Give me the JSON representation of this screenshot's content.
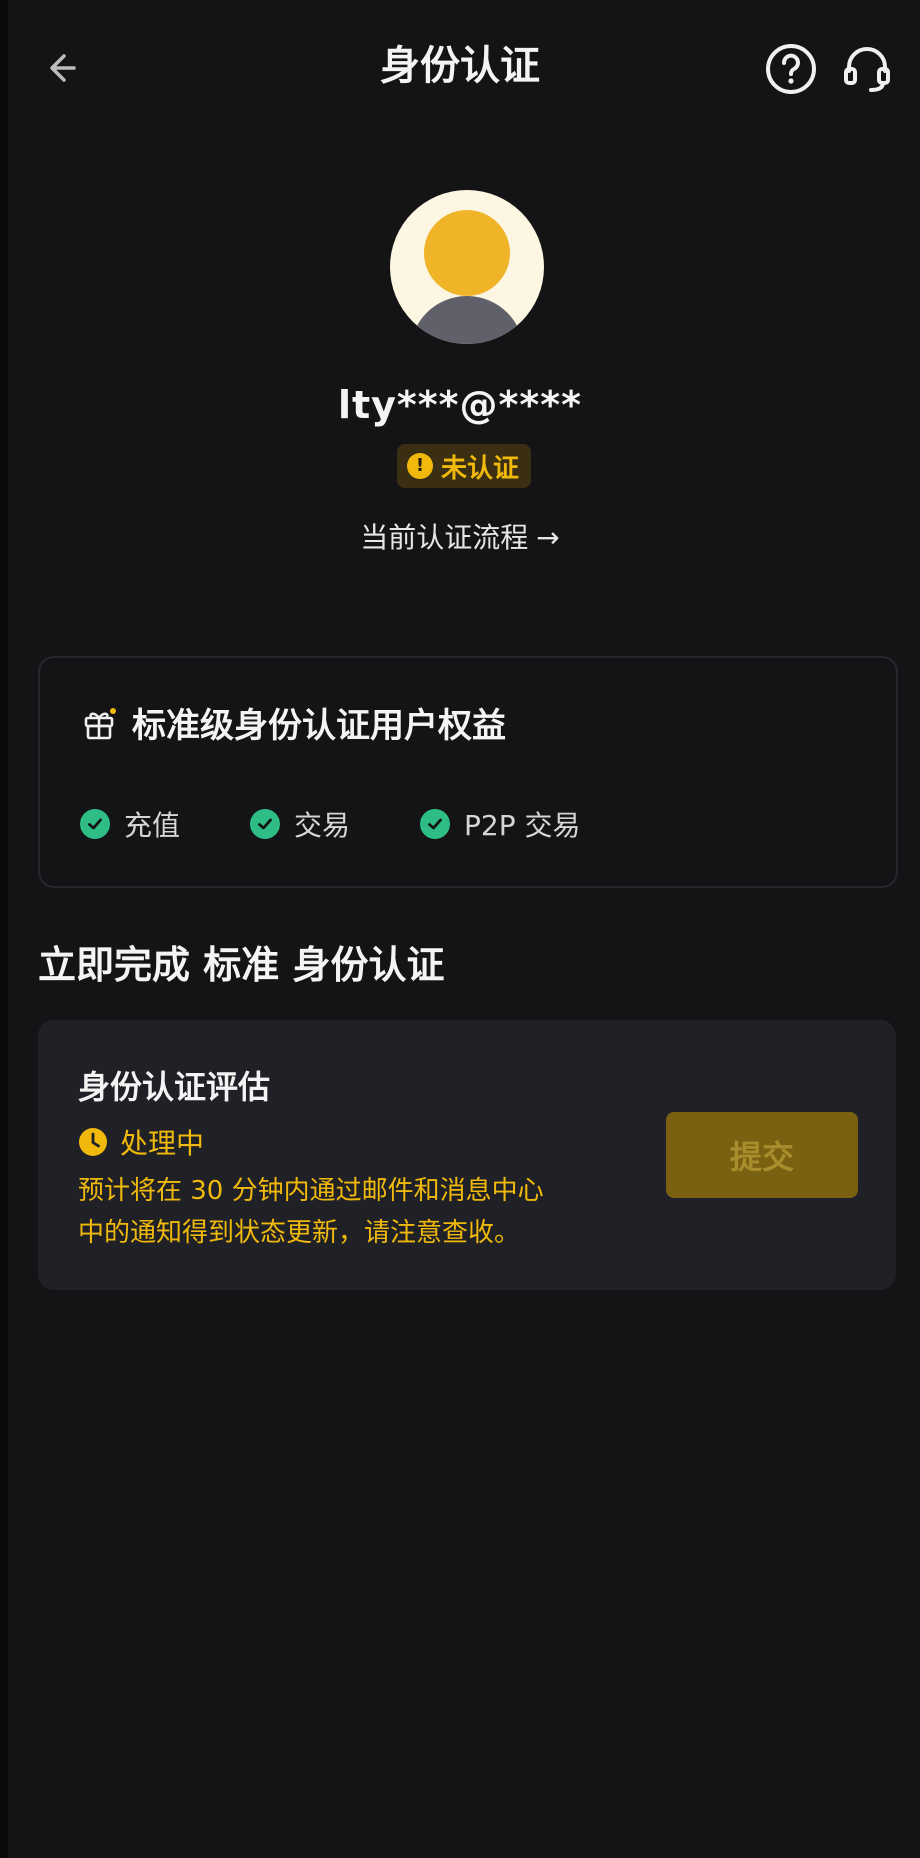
{
  "header": {
    "title": "身份认证"
  },
  "profile": {
    "username": "lty***@****",
    "status_label": "未认证",
    "process_link": "当前认证流程",
    "process_arrow": "→"
  },
  "benefits": {
    "title": "标准级身份认证用户权益",
    "items": [
      {
        "label": "充值"
      },
      {
        "label": "交易"
      },
      {
        "label": "P2P 交易"
      }
    ]
  },
  "section": {
    "heading": "立即完成 标准 身份认证"
  },
  "assessment": {
    "title": "身份认证评估",
    "status": "处理中",
    "description_line1": "预计将在 30 分钟内通过邮件和消息中心",
    "description_line2": "中的通知得到状态更新，请注意查收。",
    "submit_label": "提交"
  },
  "colors": {
    "accent": "#f0b90b",
    "success": "#2ebd85",
    "background": "#141416",
    "card": "#202126"
  },
  "icons": {
    "back": "arrow-left-icon",
    "help": "question-circle-icon",
    "support": "headset-icon",
    "status": "exclamation-icon",
    "benefits": "gift-icon",
    "check": "check-circle-icon",
    "clock": "clock-icon"
  }
}
